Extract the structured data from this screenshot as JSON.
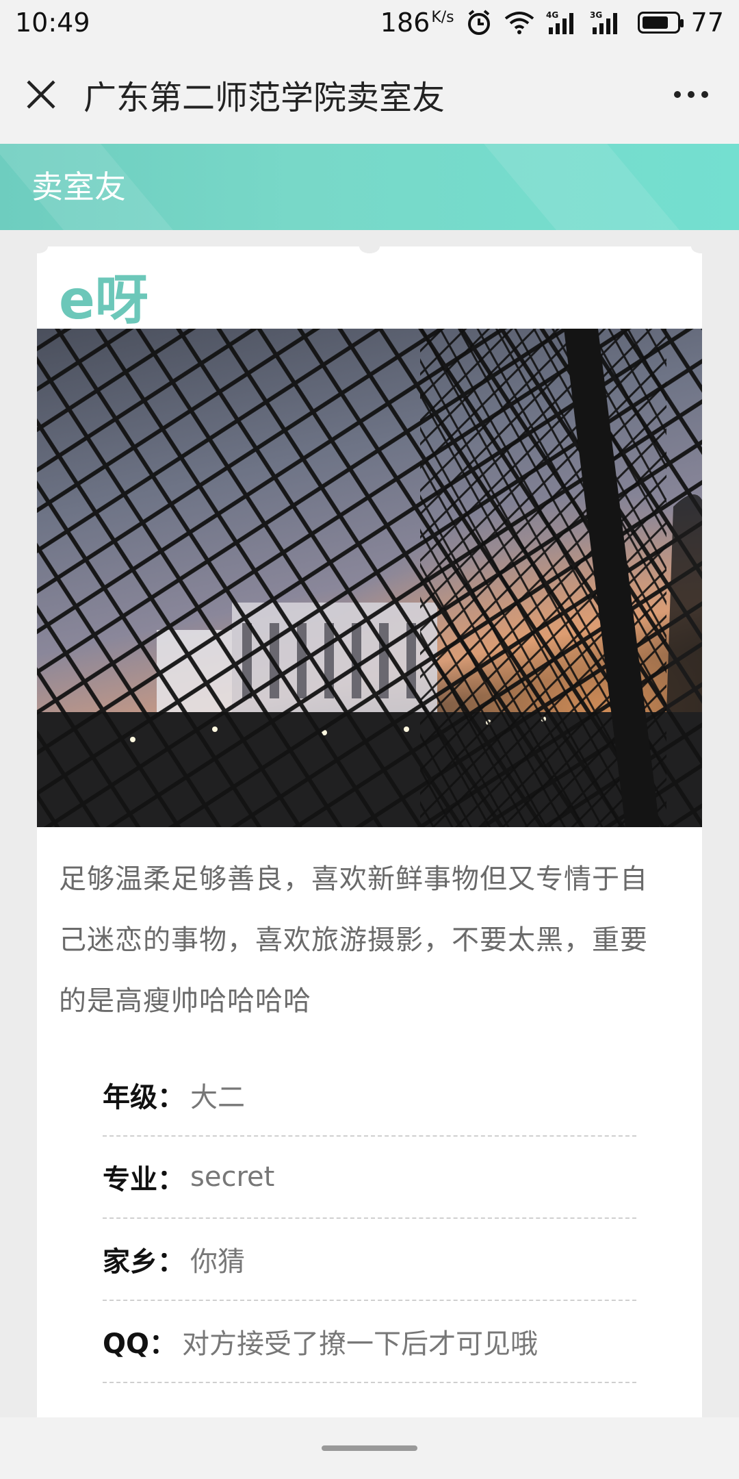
{
  "status_bar": {
    "time": "10:49",
    "net_speed": "186",
    "net_speed_unit": "K/s",
    "network_1": "4G",
    "network_2": "3G",
    "battery": "77",
    "battery_level": 0.77
  },
  "header": {
    "title": "广东第二师范学院卖室友",
    "close_icon": "close-icon",
    "more_icon": "more-dots-icon"
  },
  "banner": {
    "title": "卖室友",
    "color": "#74dfd0"
  },
  "profile": {
    "name": "e呀",
    "name_color": "#6cc7b9",
    "photo_description": "chain-link-fence-sunset-photo",
    "description_lines": [
      "足够温柔足够善良，喜欢新鲜事物但又专情于自",
      "己迷恋的事物，喜欢旅游摄影，不要太黑，重要",
      "的是高瘦帅哈哈哈哈"
    ],
    "info": [
      {
        "label": "年级：",
        "value": "大二"
      },
      {
        "label": "专业：",
        "value": "secret"
      },
      {
        "label": "家乡：",
        "value": "你猜"
      },
      {
        "label": "QQ：",
        "value": "对方接受了撩一下后才可见哦"
      }
    ]
  }
}
